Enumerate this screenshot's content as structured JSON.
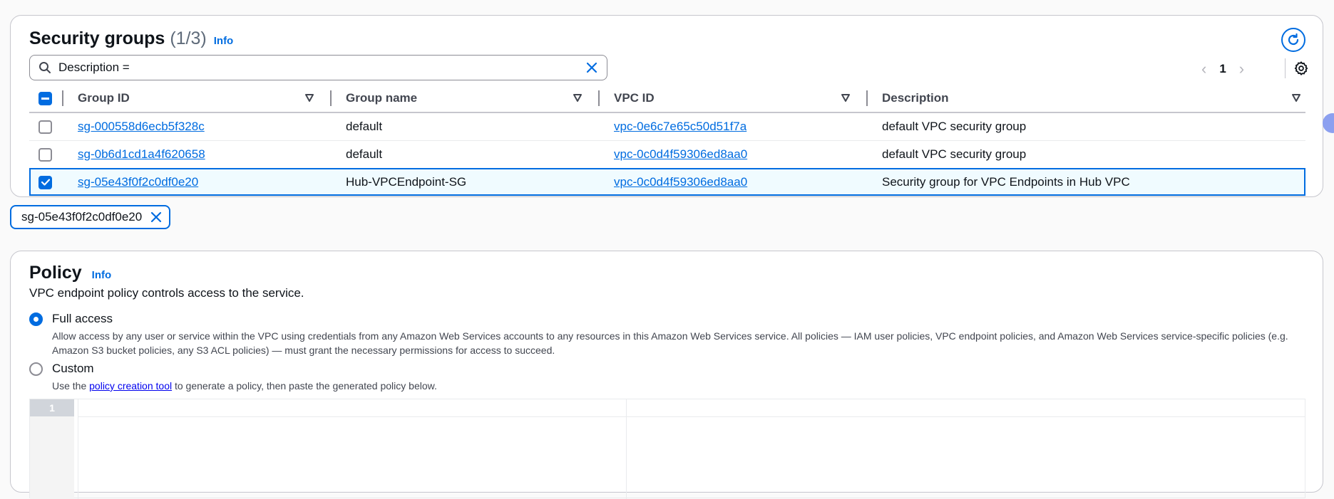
{
  "security_groups": {
    "title": "Security groups",
    "count": "(1/3)",
    "info": "Info",
    "search": {
      "value": "Description ="
    },
    "pagination": {
      "page": "1"
    },
    "columns": [
      "Group ID",
      "Group name",
      "VPC ID",
      "Description"
    ],
    "rows": [
      {
        "group_id": "sg-000558d6ecb5f328c",
        "group_name": "default",
        "vpc_id": "vpc-0e6c7e65c50d51f7a",
        "description": "default VPC security group"
      },
      {
        "group_id": "sg-0b6d1cd1a4f620658",
        "group_name": "default",
        "vpc_id": "vpc-0c0d4f59306ed8aa0",
        "description": "default VPC security group"
      },
      {
        "group_id": "sg-05e43f0f2c0df0e20",
        "group_name": "Hub-VPCEndpoint-SG",
        "vpc_id": "vpc-0c0d4f59306ed8aa0",
        "description": "Security group for VPC Endpoints in Hub VPC"
      }
    ],
    "selected_token": "sg-05e43f0f2c0df0e20"
  },
  "policy": {
    "title": "Policy",
    "info": "Info",
    "description": "VPC endpoint policy controls access to the service.",
    "full_access": {
      "label": "Full access",
      "description": "Allow access by any user or service within the VPC using credentials from any Amazon Web Services accounts to any resources in this Amazon Web Services service. All policies — IAM user policies, VPC endpoint policies, and Amazon Web Services service-specific policies (e.g. Amazon S3 bucket policies, any S3 ACL policies) — must grant the necessary permissions for access to succeed."
    },
    "custom": {
      "label": "Custom",
      "desc_prefix": "Use the ",
      "desc_link": "policy creation tool",
      "desc_suffix": " to generate a policy, then paste the generated policy below."
    },
    "editor": {
      "line_number": "1"
    }
  },
  "colors": {
    "accent": "#006ce0",
    "text": "#0f141a",
    "border": "#c6c6cd"
  }
}
